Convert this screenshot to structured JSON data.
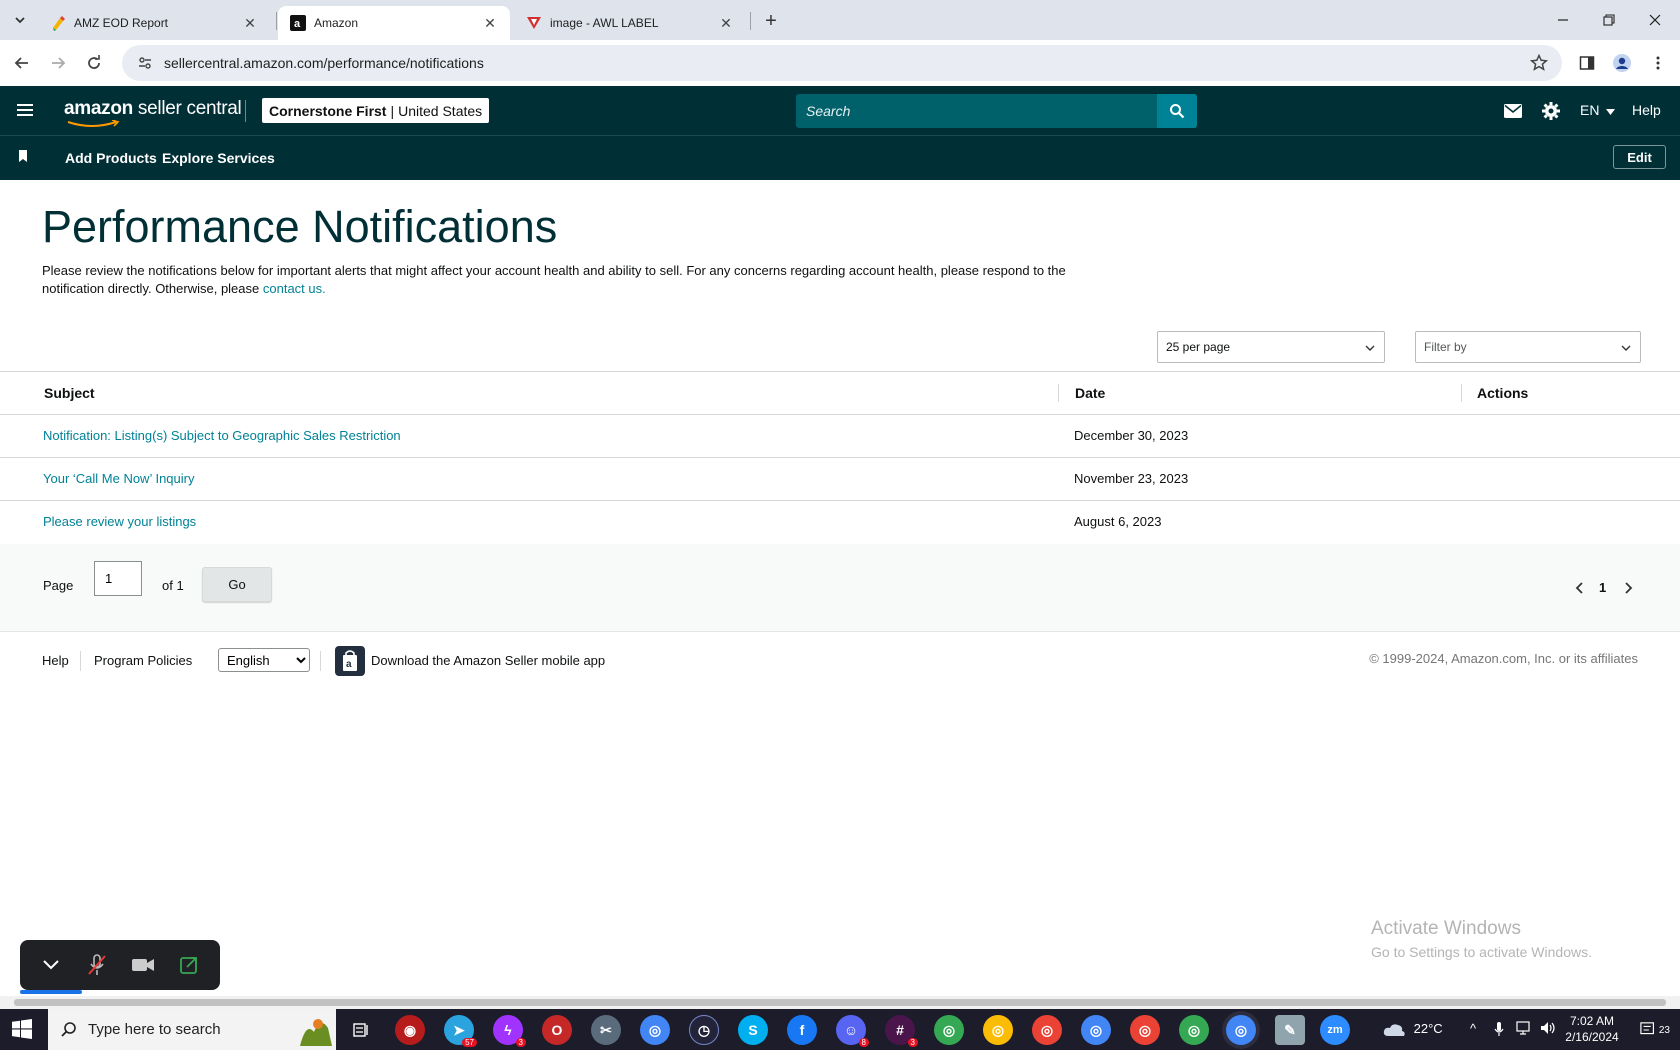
{
  "browser": {
    "tabs": [
      {
        "title": "AMZ EOD Report",
        "icon": "google-sheets-icon"
      },
      {
        "title": "Amazon",
        "icon": "amazon-icon"
      },
      {
        "title": "image - AWL LABEL",
        "icon": "awl-label-icon"
      }
    ],
    "url": "sellercentral.amazon.com/performance/notifications"
  },
  "header": {
    "logo_bold": "amazon",
    "logo_rest": " seller central",
    "account_name": "Cornerstone First",
    "account_sep": "|",
    "account_region": "United States",
    "search_placeholder": "Search",
    "lang": "EN",
    "help": "Help"
  },
  "subnav": {
    "items": [
      "Add Products",
      "Explore Services"
    ],
    "edit": "Edit"
  },
  "page": {
    "title": "Performance Notifications",
    "intro": "Please review the notifications below for important alerts that might affect your account health and ability to sell. For any concerns regarding account health, please respond to the notification directly. Otherwise, please ",
    "intro_link": "contact us.",
    "per_page": "25 per page",
    "filter_by": "Filter by"
  },
  "table": {
    "columns": [
      "Subject",
      "Date",
      "Actions"
    ],
    "rows": [
      {
        "subject": "Notification: Listing(s) Subject to Geographic Sales Restriction",
        "date": "December 30, 2023"
      },
      {
        "subject": "Your ‘Call Me Now’ Inquiry",
        "date": "November 23, 2023"
      },
      {
        "subject": "Please review your listings",
        "date": "August 6, 2023"
      }
    ]
  },
  "pager": {
    "page_label": "Page",
    "page_value": "1",
    "of_label": "of 1",
    "go": "Go",
    "current": "1"
  },
  "footer": {
    "help": "Help",
    "policies": "Program Policies",
    "language": "English",
    "app_text": "Download the Amazon Seller mobile app",
    "copyright": "© 1999-2024, Amazon.com, Inc. or its affiliates"
  },
  "watermark": {
    "line1": "Activate Windows",
    "line2": "Go to Settings to activate Windows."
  },
  "taskbar": {
    "search_placeholder": "Type here to search",
    "weather": "22°C",
    "time": "7:02 AM",
    "date": "2/16/2024",
    "notifications": "23",
    "badges": {
      "telegram": "57",
      "messenger": "3",
      "discord": "8",
      "slack": "3"
    }
  },
  "colors": {
    "header_bg": "#002f36",
    "search_bg": "#00616b",
    "link": "#008296"
  }
}
